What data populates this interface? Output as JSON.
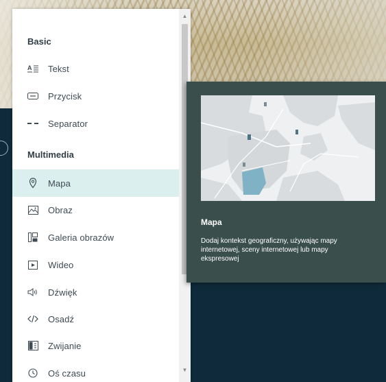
{
  "panel": {
    "sections": [
      {
        "title": "Basic"
      },
      {
        "title": "Multimedia"
      }
    ],
    "basic_items": [
      {
        "label": "Tekst",
        "icon": "text-icon"
      },
      {
        "label": "Przycisk",
        "icon": "button-icon"
      },
      {
        "label": "Separator",
        "icon": "separator-icon"
      }
    ],
    "multimedia_items": [
      {
        "label": "Mapa",
        "icon": "map-pin-icon",
        "active": true
      },
      {
        "label": "Obraz",
        "icon": "image-icon"
      },
      {
        "label": "Galeria obrazów",
        "icon": "gallery-icon"
      },
      {
        "label": "Wideo",
        "icon": "video-icon"
      },
      {
        "label": "Dźwięk",
        "icon": "audio-icon"
      },
      {
        "label": "Osadź",
        "icon": "embed-icon"
      },
      {
        "label": "Zwijanie",
        "icon": "collapse-icon"
      },
      {
        "label": "Oś czasu",
        "icon": "timeline-icon"
      }
    ]
  },
  "card": {
    "title": "Mapa",
    "description": "Dodaj kontekst geograficzny, używając mapy internetowej, sceny internetowej lub mapy ekspresowej"
  },
  "colors": {
    "dark_background": "#0f2a3a",
    "card_background": "#3a4f4c",
    "active_item": "#dcefef",
    "map_water": "#eef0f1",
    "map_land": "#d7dadc",
    "map_highlight": "#7fb2c4"
  }
}
